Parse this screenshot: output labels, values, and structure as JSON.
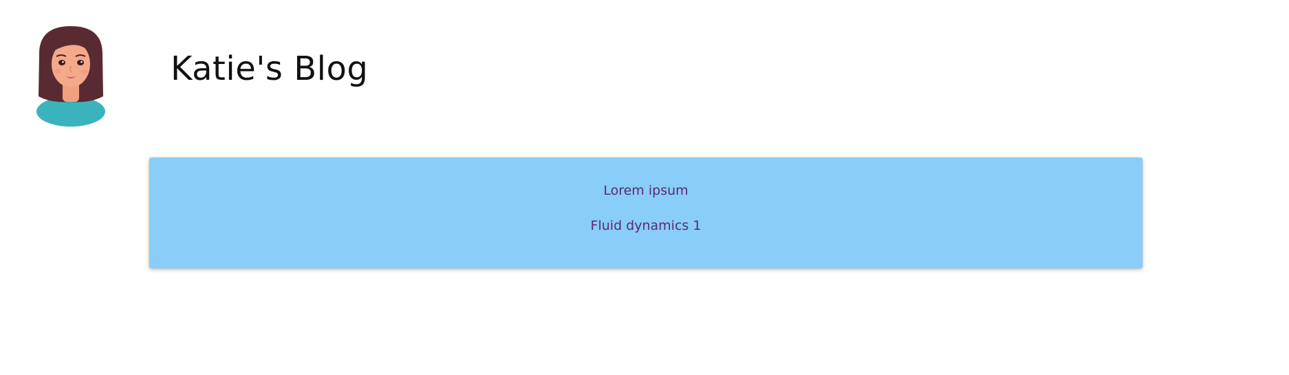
{
  "header": {
    "avatar_icon": "woman-avatar-icon",
    "title": "Katie's Blog"
  },
  "posts": [
    {
      "title": "Lorem ipsum",
      "subtitle": "Fluid dynamics 1"
    }
  ],
  "colors": {
    "card_background": "#89cdf9",
    "link_text": "#5b2a6e",
    "title_text": "#111111",
    "hair": "#5a2a32",
    "skin": "#f4a98a",
    "shirt": "#3bb3bd"
  }
}
